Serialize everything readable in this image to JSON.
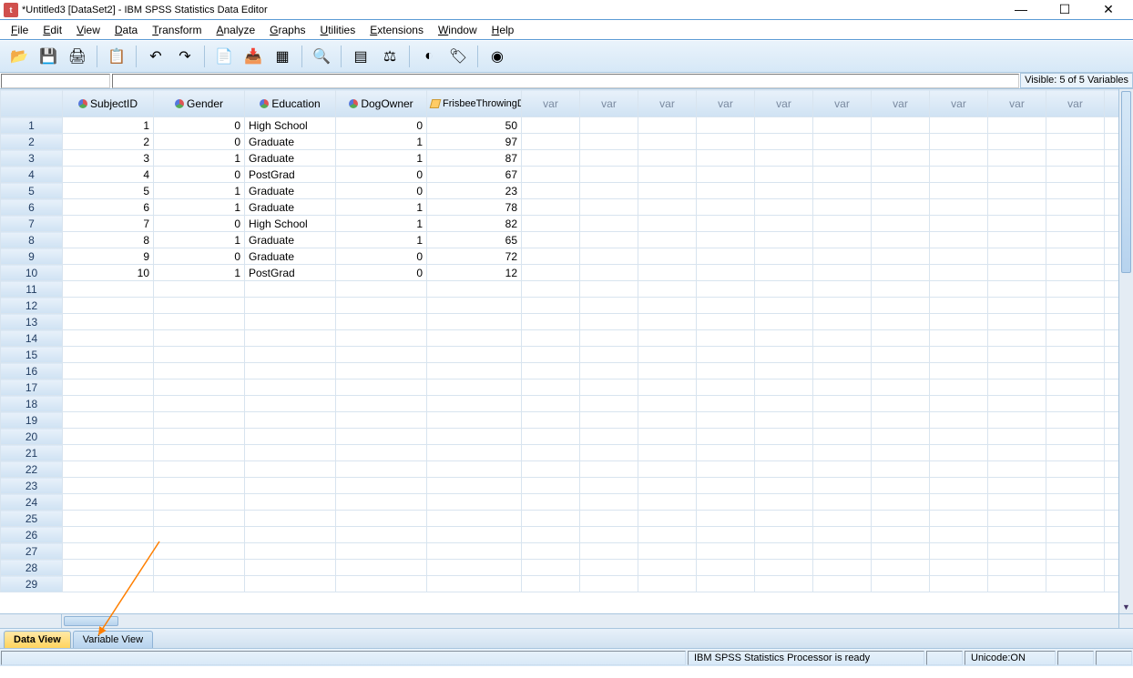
{
  "window": {
    "title": "*Untitled3 [DataSet2] - IBM SPSS Statistics Data Editor"
  },
  "menu": [
    "File",
    "Edit",
    "View",
    "Data",
    "Transform",
    "Analyze",
    "Graphs",
    "Utilities",
    "Extensions",
    "Window",
    "Help"
  ],
  "visible_text": "Visible: 5 of 5 Variables",
  "columns": [
    {
      "name": "SubjectID",
      "icon": "var"
    },
    {
      "name": "Gender",
      "icon": "var"
    },
    {
      "name": "Education",
      "icon": "var"
    },
    {
      "name": "DogOwner",
      "icon": "var"
    },
    {
      "name": "FrisbeeThrowingDistanceMetres",
      "icon": "ruler"
    }
  ],
  "empty_col_label": "var",
  "rows": [
    {
      "SubjectID": "1",
      "Gender": "0",
      "Education": "High School",
      "DogOwner": "0",
      "FrisbeeThrowingDistanceMetres": "50"
    },
    {
      "SubjectID": "2",
      "Gender": "0",
      "Education": "Graduate",
      "DogOwner": "1",
      "FrisbeeThrowingDistanceMetres": "97"
    },
    {
      "SubjectID": "3",
      "Gender": "1",
      "Education": "Graduate",
      "DogOwner": "1",
      "FrisbeeThrowingDistanceMetres": "87"
    },
    {
      "SubjectID": "4",
      "Gender": "0",
      "Education": "PostGrad",
      "DogOwner": "0",
      "FrisbeeThrowingDistanceMetres": "67"
    },
    {
      "SubjectID": "5",
      "Gender": "1",
      "Education": "Graduate",
      "DogOwner": "0",
      "FrisbeeThrowingDistanceMetres": "23"
    },
    {
      "SubjectID": "6",
      "Gender": "1",
      "Education": "Graduate",
      "DogOwner": "1",
      "FrisbeeThrowingDistanceMetres": "78"
    },
    {
      "SubjectID": "7",
      "Gender": "0",
      "Education": "High School",
      "DogOwner": "1",
      "FrisbeeThrowingDistanceMetres": "82"
    },
    {
      "SubjectID": "8",
      "Gender": "1",
      "Education": "Graduate",
      "DogOwner": "1",
      "FrisbeeThrowingDistanceMetres": "65"
    },
    {
      "SubjectID": "9",
      "Gender": "0",
      "Education": "Graduate",
      "DogOwner": "0",
      "FrisbeeThrowingDistanceMetres": "72"
    },
    {
      "SubjectID": "10",
      "Gender": "1",
      "Education": "PostGrad",
      "DogOwner": "0",
      "FrisbeeThrowingDistanceMetres": "12"
    }
  ],
  "total_visible_rows": 29,
  "tabs": {
    "data": "Data View",
    "variable": "Variable View"
  },
  "status": {
    "processor": "IBM SPSS Statistics Processor is ready",
    "unicode": "Unicode:ON"
  },
  "toolbar_icons": [
    "open",
    "save",
    "print",
    "",
    "recent",
    "",
    "undo",
    "redo",
    "",
    "goto-case",
    "goto-var",
    "vars",
    "",
    "find",
    "",
    "split",
    "weight",
    "",
    "select",
    "value-labels",
    "",
    "use-sets"
  ]
}
